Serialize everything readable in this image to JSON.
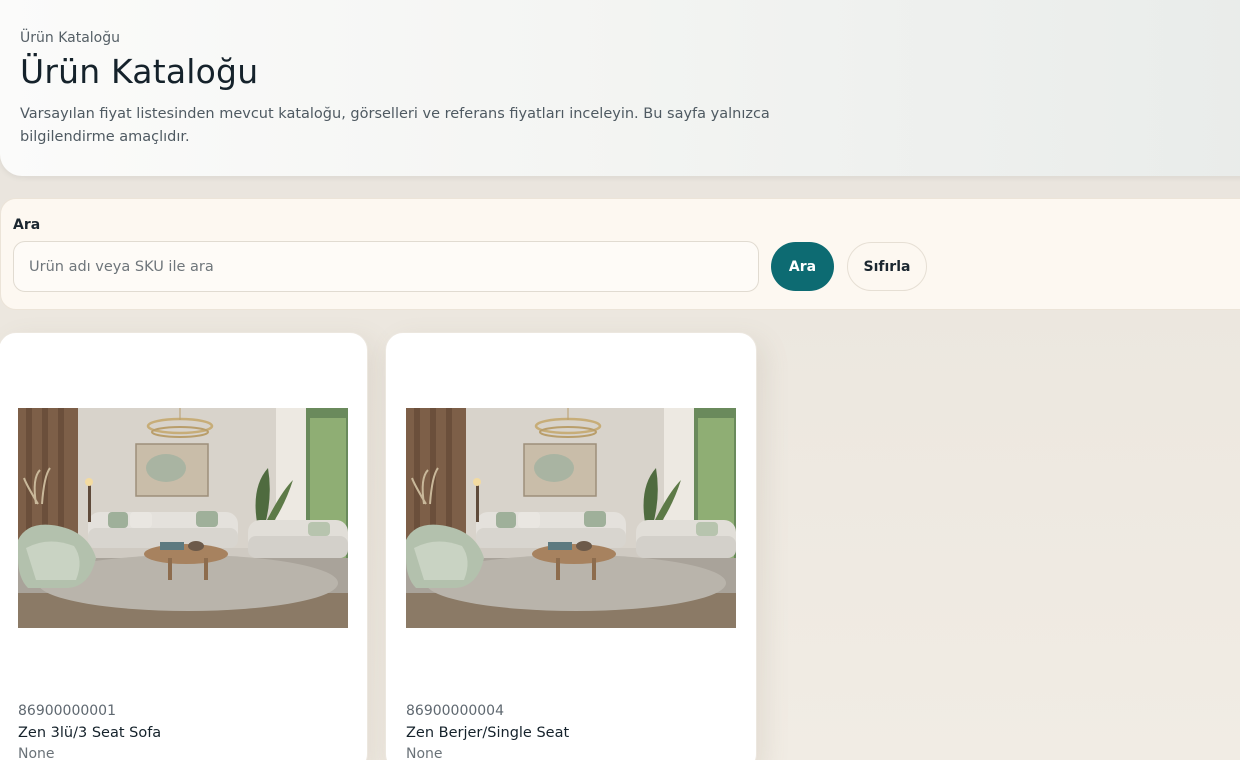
{
  "header": {
    "breadcrumb": "Ürün Kataloğu",
    "title": "Ürün Kataloğu",
    "description": "Varsayılan fiyat listesinden mevcut kataloğu, görselleri ve referans fiyatları inceleyin. Bu sayfa yalnızca bilgilendirme amaçlıdır."
  },
  "search": {
    "label": "Ara",
    "placeholder": "Ürün adı veya SKU ile ara",
    "value": "",
    "search_button": "Ara",
    "reset_button": "Sıfırla"
  },
  "products": [
    {
      "sku": "86900000001",
      "name": "Zen 3lü/3 Seat Sofa",
      "category": "None"
    },
    {
      "sku": "86900000004",
      "name": "Zen Berjer/Single Seat",
      "category": "None"
    }
  ],
  "colors": {
    "accent": "#0d6b72",
    "page_bg": "#ece8e1",
    "card_bg": "#ffffff",
    "search_bg": "#fdf8f1"
  }
}
